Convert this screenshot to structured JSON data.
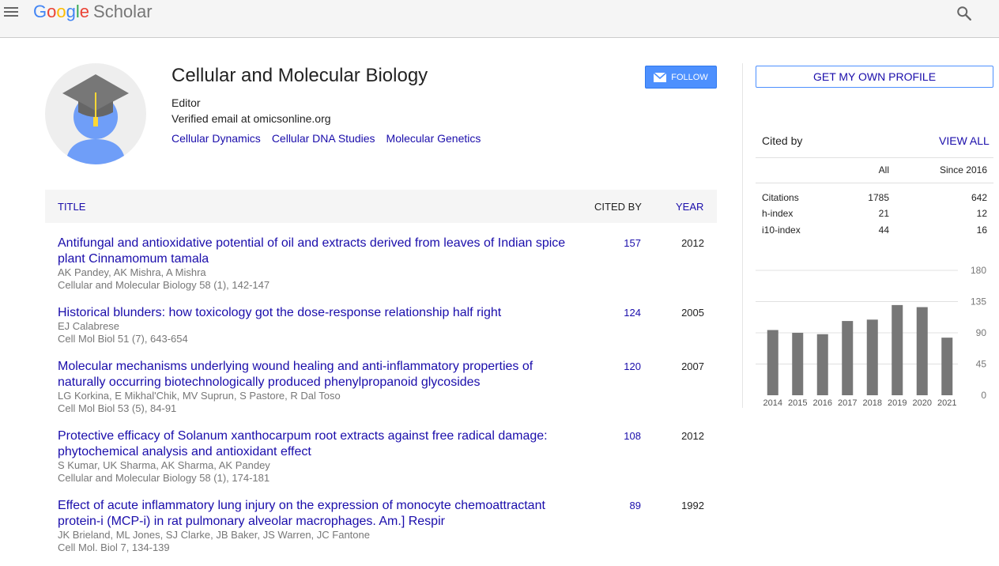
{
  "header": {
    "logo_letters": [
      "G",
      "o",
      "o",
      "g",
      "l",
      "e"
    ],
    "logo_product": "Scholar"
  },
  "profile": {
    "name": "Cellular and Molecular Biology",
    "affiliation": "Editor",
    "email": "Verified email at omicsonline.org",
    "interests": [
      "Cellular Dynamics",
      "Cellular DNA Studies",
      "Molecular Genetics"
    ],
    "follow_label": "FOLLOW"
  },
  "table": {
    "headers": {
      "title": "TITLE",
      "cited_by": "CITED BY",
      "year": "YEAR"
    },
    "articles": [
      {
        "title": "Antifungal and antioxidative potential of oil and extracts derived from leaves of Indian spice plant Cinnamomum tamala",
        "authors": "AK Pandey, AK Mishra, A Mishra",
        "venue": "Cellular and Molecular Biology 58 (1), 142-147",
        "cited_by": "157",
        "year": "2012"
      },
      {
        "title": "Historical blunders: how toxicology got the dose-response relationship half right",
        "authors": "EJ Calabrese",
        "venue": "Cell Mol Biol 51 (7), 643-654",
        "cited_by": "124",
        "year": "2005"
      },
      {
        "title": "Molecular mechanisms underlying wound healing and anti-inflammatory properties of naturally occurring biotechnologically produced phenylpropanoid glycosides",
        "authors": "LG Korkina, E Mikhal'Chik, MV Suprun, S Pastore, R Dal Toso",
        "venue": "Cell Mol Biol 53 (5), 84-91",
        "cited_by": "120",
        "year": "2007"
      },
      {
        "title": "Protective efficacy of Solanum xanthocarpum root extracts against free radical damage: phytochemical analysis and antioxidant effect",
        "authors": "S Kumar, UK Sharma, AK Sharma, AK Pandey",
        "venue": "Cellular and Molecular Biology 58 (1), 174-181",
        "cited_by": "108",
        "year": "2012"
      },
      {
        "title": "Effect of acute inflammatory lung injury on the expression of monocyte chemoattractant protein-i (MCP-i) in rat pulmonary alveolar macrophages. Am.] Respir",
        "authors": "JK Brieland, ML Jones, SJ Clarke, JB Baker, JS Warren, JC Fantone",
        "venue": "Cell Mol. Biol 7, 134-139",
        "cited_by": "89",
        "year": "1992"
      }
    ]
  },
  "sidebar": {
    "own_profile_label": "GET MY OWN PROFILE",
    "cited_by_label": "Cited by",
    "view_all_label": "VIEW ALL",
    "columns": {
      "all": "All",
      "since": "Since 2016"
    },
    "stats": [
      {
        "label": "Citations",
        "all": "1785",
        "since": "642"
      },
      {
        "label": "h-index",
        "all": "21",
        "since": "12"
      },
      {
        "label": "i10-index",
        "all": "44",
        "since": "16"
      }
    ]
  },
  "chart_data": {
    "type": "bar",
    "categories": [
      "2014",
      "2015",
      "2016",
      "2017",
      "2018",
      "2019",
      "2020",
      "2021"
    ],
    "values": [
      94,
      90,
      88,
      107,
      109,
      130,
      127,
      83
    ],
    "yticks": [
      "0",
      "45",
      "90",
      "135",
      "180"
    ],
    "ylim": [
      0,
      180
    ],
    "bar_color": "#777777"
  }
}
